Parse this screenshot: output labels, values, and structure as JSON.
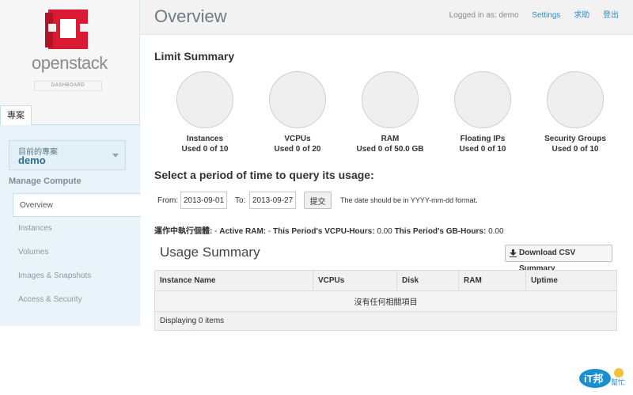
{
  "brand": {
    "name": "openstack",
    "subtitle": "DASHBOARD",
    "color": "#da1a32"
  },
  "sidebar": {
    "project_tab": "專案",
    "project_switcher": {
      "label": "目前的專案",
      "value": "demo"
    },
    "section_title": "Manage Compute",
    "items": [
      {
        "label": "Overview",
        "active": true
      },
      {
        "label": "Instances",
        "active": false
      },
      {
        "label": "Volumes",
        "active": false
      },
      {
        "label": "Images & Snapshots",
        "active": false
      },
      {
        "label": "Access & Security",
        "active": false
      }
    ]
  },
  "header": {
    "title": "Overview",
    "logged_in": "Logged in as: demo",
    "settings": "Settings",
    "help": "求助",
    "signout": "登出"
  },
  "limit_summary": {
    "title": "Limit Summary",
    "items": [
      {
        "name": "Instances",
        "used": "Used 0 of 10"
      },
      {
        "name": "VCPUs",
        "used": "Used 0 of 20"
      },
      {
        "name": "RAM",
        "used": "Used 0 of 50.0 GB"
      },
      {
        "name": "Floating IPs",
        "used": "Used 0 of 10"
      },
      {
        "name": "Security Groups",
        "used": "Used 0 of 10"
      }
    ]
  },
  "period": {
    "title": "Select a period of time to query its usage:",
    "from_label": "From:",
    "from_value": "2013-09-01",
    "to_label": "To:",
    "to_value": "2013-09-27",
    "submit": "提交",
    "hint": "The date should be in YYYY-mm-dd format."
  },
  "active_stats": {
    "label1": "運作中執行個體:",
    "value1": " - ",
    "label2": "Active RAM:",
    "value2": " - ",
    "label3": "This Period's VCPU-Hours:",
    "value3": " 0.00 ",
    "label4": "This Period's GB-Hours:",
    "value4": " 0.00"
  },
  "usage": {
    "title": "Usage Summary",
    "csv_button": "Download CSV Summary",
    "columns": [
      "Instance Name",
      "VCPUs",
      "Disk",
      "RAM",
      "Uptime"
    ],
    "empty_message": "沒有任何相關項目",
    "footer": "Displaying 0 items"
  },
  "watermark": {
    "text": "iT邦幫忙"
  }
}
